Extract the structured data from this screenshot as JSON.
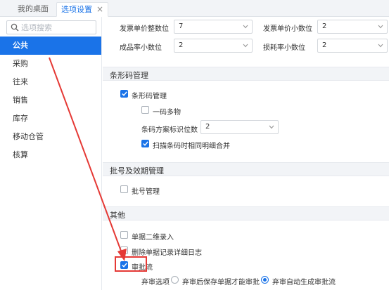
{
  "tabs": [
    {
      "label": "我的桌面"
    },
    {
      "label": "选项设置",
      "close": "×"
    }
  ],
  "sidebar": {
    "search_placeholder": "选项搜索",
    "items": [
      {
        "label": "公共"
      },
      {
        "label": "采购"
      },
      {
        "label": "往来"
      },
      {
        "label": "销售"
      },
      {
        "label": "库存"
      },
      {
        "label": "移动仓管"
      },
      {
        "label": "核算"
      }
    ]
  },
  "fields": {
    "invoice_int_digits": {
      "label": "发票单价整数位",
      "value": "7"
    },
    "invoice_dec_digits": {
      "label": "发票单价小数位",
      "value": "2"
    },
    "yield_dec_digits": {
      "label": "成品率小数位",
      "value": "2"
    },
    "loss_dec_digits": {
      "label": "损耗率小数位",
      "value": "2"
    }
  },
  "sections": {
    "barcode": {
      "title": "条形码管理",
      "enable": {
        "label": "条形码管理",
        "checked": true
      },
      "multi_code": {
        "label": "一码多物",
        "checked": false
      },
      "scheme_digits": {
        "label": "条码方案标识位数",
        "value": "2"
      },
      "merge_same": {
        "label": "扫描条码时相同明细合并",
        "checked": true
      }
    },
    "batch": {
      "title": "批号及效期管理",
      "enable": {
        "label": "批号管理",
        "checked": false
      }
    },
    "other": {
      "title": "其他",
      "qr_entry": {
        "label": "单据二维录入",
        "checked": false
      },
      "delete_log": {
        "label": "删除单据记录详细日志",
        "checked": false
      },
      "approval": {
        "label": "审批流",
        "checked": true
      },
      "approval_options": {
        "label": "弃审选项",
        "opt1": {
          "label": "弃审后保存单据才能审批",
          "selected": false
        },
        "opt2": {
          "label": "弃审自动生成审批流",
          "selected": true
        }
      }
    }
  },
  "colors": {
    "accent": "#1a73e8",
    "annotation": "#e53935"
  }
}
